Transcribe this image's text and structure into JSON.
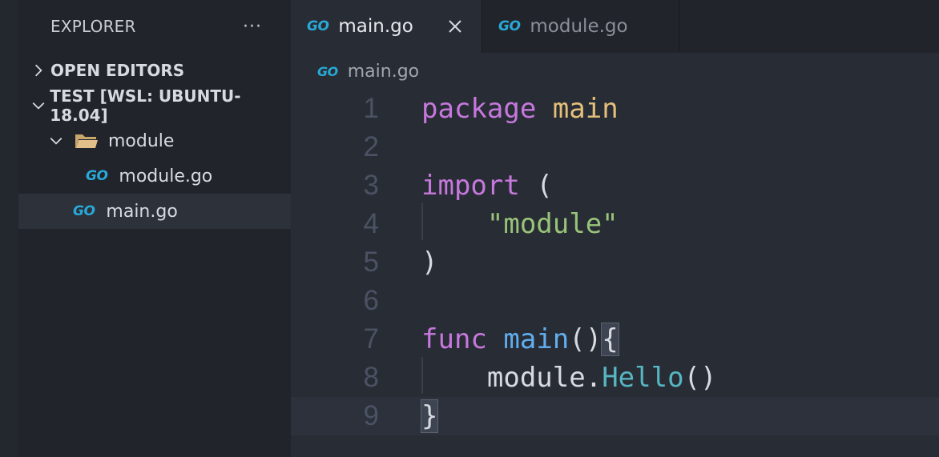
{
  "sidebar": {
    "title": "EXPLORER",
    "more": "···",
    "open_editors": "OPEN EDITORS",
    "workspace": "TEST [WSL: UBUNTU-18.04]",
    "folder": "module",
    "file_in_folder": "module.go",
    "file_root": "main.go"
  },
  "tabs": [
    {
      "label": "main.go",
      "active": true
    },
    {
      "label": "module.go",
      "active": false
    }
  ],
  "icons": {
    "go": "GO"
  },
  "breadcrumb": "main.go",
  "editor": {
    "line_numbers": [
      "1",
      "2",
      "3",
      "4",
      "5",
      "6",
      "7",
      "8",
      "9"
    ],
    "l1_kw": "package",
    "l1_name": "main",
    "l3_kw": "import",
    "l3_paren": "(",
    "l4_str": "\"module\"",
    "l5_paren": ")",
    "l7_kw": "func",
    "l7_fn": "main",
    "l7_parens": "()",
    "l7_brace": "{",
    "l8_obj": "module.",
    "l8_method": "Hello",
    "l8_parens": "()",
    "l9_brace": "}"
  },
  "colors": {
    "keyword": "#c678dd",
    "package_name": "#e5c07b",
    "string": "#98c379",
    "function": "#61afef",
    "method": "#56b6c2",
    "go_icon": "#29a9d8"
  }
}
